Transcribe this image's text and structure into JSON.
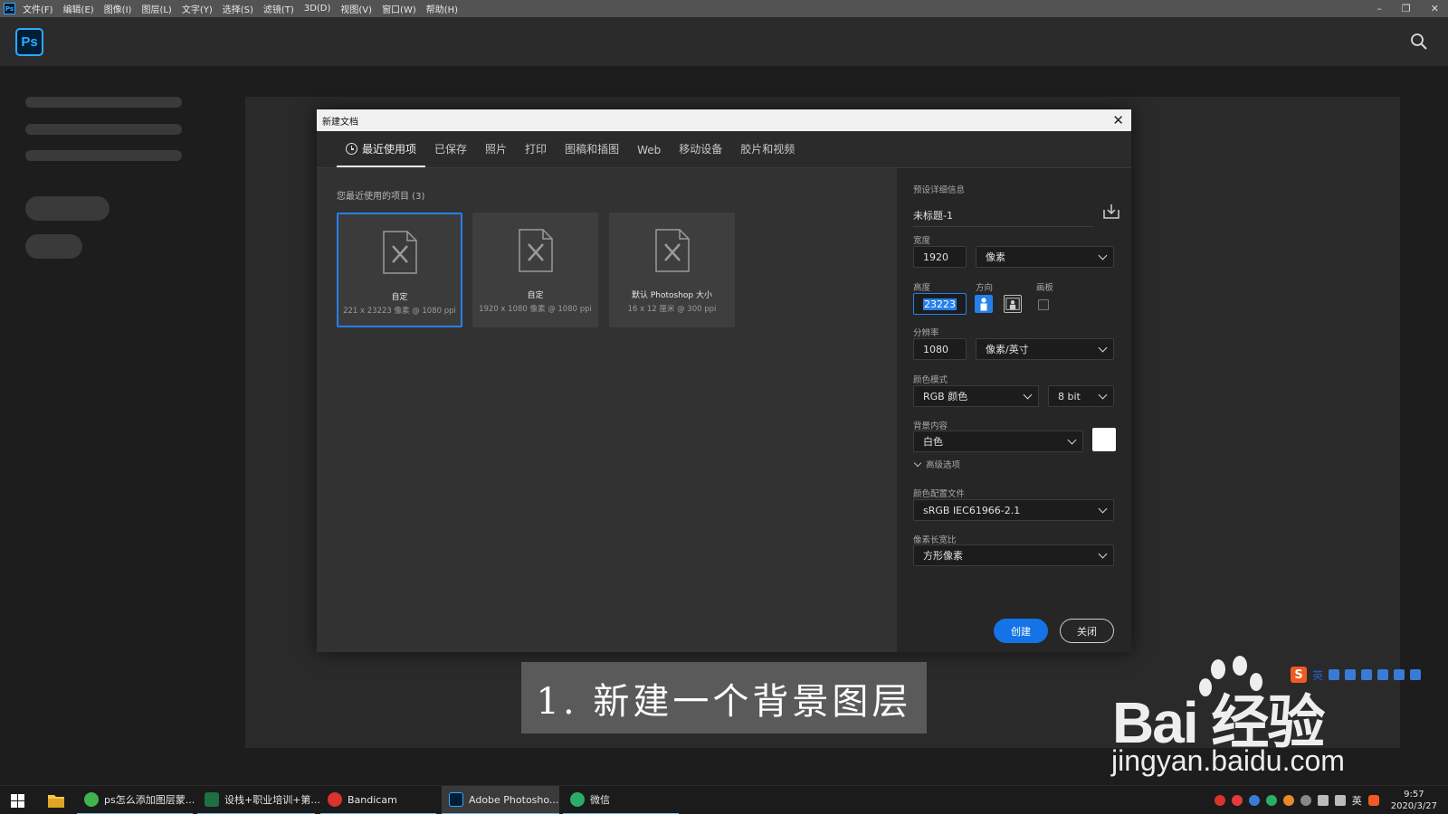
{
  "menubar": {
    "app_icon_text": "Ps",
    "items": [
      "文件(F)",
      "编辑(E)",
      "图像(I)",
      "图层(L)",
      "文字(Y)",
      "选择(S)",
      "滤镜(T)",
      "3D(D)",
      "视图(V)",
      "窗口(W)",
      "帮助(H)"
    ]
  },
  "header": {
    "logo_text": "Ps"
  },
  "dialog": {
    "title": "新建文档",
    "close_glyph": "✕",
    "tabs": [
      "最近使用项",
      "已保存",
      "照片",
      "打印",
      "图稿和插图",
      "Web",
      "移动设备",
      "胶片和视频"
    ],
    "recent_label": "您最近使用的项目 (3)",
    "recent": [
      {
        "name": "自定",
        "dims": "221 x 23223 像素 @ 1080 ppi"
      },
      {
        "name": "自定",
        "dims": "1920 x 1080 像素 @ 1080 ppi"
      },
      {
        "name": "默认 Photoshop 大小",
        "dims": "16 x 12 厘米 @ 300 ppi"
      }
    ],
    "details": {
      "section_label": "预设详细信息",
      "preset_name": "未标题-1",
      "width_label": "宽度",
      "width_value": "1920",
      "width_unit": "像素",
      "height_label": "高度",
      "height_value": "23223",
      "orientation_label": "方向",
      "artboard_label": "画板",
      "resolution_label": "分辨率",
      "resolution_value": "1080",
      "resolution_unit": "像素/英寸",
      "color_mode_label": "颜色模式",
      "color_mode": "RGB 颜色",
      "bit_depth": "8 bit",
      "bg_label": "背景内容",
      "bg_value": "白色",
      "bg_color": "#ffffff",
      "advanced_label": "高级选项",
      "profile_label": "颜色配置文件",
      "profile_value": "sRGB IEC61966-2.1",
      "pixel_aspect_label": "像素长宽比",
      "pixel_aspect_value": "方形像素"
    },
    "buttons": {
      "create": "创建",
      "close": "关闭"
    },
    "accent_color": "#2680eb"
  },
  "caption": "1. 新建一个背景图层",
  "watermark": {
    "brand": "Bai  经验",
    "url": "jingyan.baidu.com"
  },
  "ime": {
    "logo": "S",
    "lang": "英"
  },
  "taskbar": {
    "tasks": [
      {
        "label": "ps怎么添加图层蒙...",
        "icon_color": "#3fb34f"
      },
      {
        "label": "设栈+职业培训+第...",
        "icon_color": "#1d7044"
      },
      {
        "label": "Bandicam",
        "icon_color": "#d9342b"
      },
      {
        "label": "Adobe Photosho...",
        "icon_color": "#001e36"
      },
      {
        "label": "微信",
        "icon_color": "#2aae67"
      }
    ],
    "tray_lang": "英",
    "time": "9:57",
    "date": "2020/3/27"
  }
}
